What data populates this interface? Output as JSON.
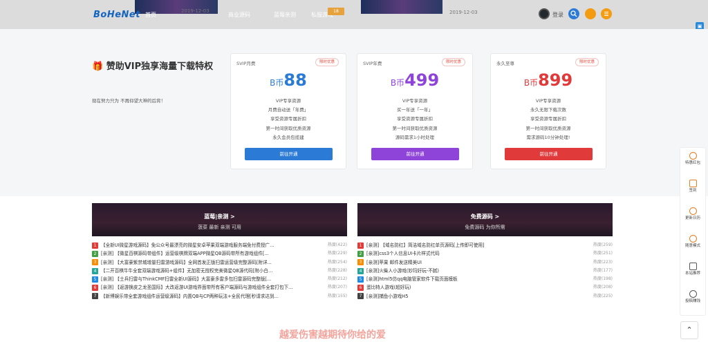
{
  "topbar": {
    "logo": "BoHeNet",
    "nav": [
      "首页",
      "商业源码",
      "蓝莓亲测",
      "私服游戏"
    ],
    "badge": "18",
    "dates": [
      "2019-12-03",
      "2019-12-03"
    ],
    "login": "登录"
  },
  "vip": {
    "title": "赞助VIP独享海量下载特权",
    "subtitle": "现在努力只为 不再仰望大神的后背！",
    "plans": [
      {
        "name": "SVIP月费",
        "badge": "限时优惠",
        "prefix": "B币",
        "price": "88",
        "color": "#2b7bd6",
        "features": [
          "VIP专享资源",
          "月费自动送「年费」",
          "享受资源专属折扣",
          "第一时间获取优质资源",
          "永久会员包揽建"
        ],
        "button": "前往开通"
      },
      {
        "name": "SVIP年费",
        "badge": "限时优惠",
        "prefix": "B币",
        "price": "499",
        "color": "#8e44d8",
        "features": [
          "VIP专享资源",
          "买一年送「一年」",
          "享受资源专属折扣",
          "第一时间获取优质资源",
          "源码需求1小时处理"
        ],
        "button": "前往开通"
      },
      {
        "name": "永久至尊",
        "badge": "限时优惠",
        "prefix": "B币",
        "price": "899",
        "color": "#e03a3a",
        "features": [
          "VIP专享资源",
          "永久无限下载次数",
          "享受资源专属折扣",
          "第一时间获取优质资源",
          "需求源码10分钟处理!"
        ],
        "button": "前往开通"
      }
    ]
  },
  "lists": [
    {
      "title": "蓝莓|亲测 >",
      "subtitle": "菠菜 最新 亲测 可用",
      "items": [
        {
          "text": "【全新UI微星游戏源码】免公众号最漂亮的微星安卓苹果双端游戏服务端免付费授广...",
          "heat": "热度(422)"
        },
        {
          "text": "[亲测] 【微星百棋源码带组件】运营级棋牌双端APP微星QB源码带所有游戏组件[...",
          "heat": "热度(229)"
        },
        {
          "text": "[亲测] 【大富豪紫禁城增量扫雷游戏源码】全网首发正版扫雷运营级完整源码[附详...",
          "heat": "热度(254)"
        },
        {
          "text": "【二开百棋牛牛全套双端游戏源码+组件】无加密无授权完美微星QB源代码[附小白...",
          "heat": "热度(228)"
        },
        {
          "text": "[亲测] 【士兵扫雷与ThinkCMF扫雷全新UI源码】大富豪多雷多包扫雷源码完整版[...",
          "heat": "热度(212)"
        },
        {
          "text": "[亲测] 【返游换皮之龙圣国际】大改返游UI游戏界面带所有客户端源码与游戏组件全套打包下...",
          "heat": "热度(207)"
        },
        {
          "text": "【新博娱乐带全套游戏组件运营级源码】内置QB与CP两种玩法+全民代理[秒请求达到...",
          "heat": "热度(155)"
        }
      ]
    },
    {
      "title": "免费源码 >",
      "subtitle": "免费源码 为你所需",
      "items": [
        {
          "text": "[亲测] 【域名防红】简洁域名防红单页源码[上传即可使用]",
          "heat": "热度(259)"
        },
        {
          "text": "[亲测]css3个人信息UI卡片样式代码",
          "heat": "热度(251)"
        },
        {
          "text": "[亲测]苹果 邮件发送精美UI",
          "heat": "热度(223)"
        },
        {
          "text": "[亲测]火柴人小游戏(妙玛好玩-不腻)",
          "heat": "热度(177)"
        },
        {
          "text": "[亲测]html5仿qq电脑管家软件下载页面模板",
          "heat": "热度(198)"
        },
        {
          "text": "蛋比特人游戏(超好玩)",
          "heat": "热度(208)"
        },
        {
          "text": "[亲测]捕鱼小游戏H5",
          "heat": "热度(225)"
        }
      ]
    }
  ],
  "rank_colors": [
    "#e53935",
    "#43a047",
    "#fb8c00",
    "#26a69a",
    "#1e88e5",
    "#e53935",
    "#424242"
  ],
  "sidebar": [
    "特惠红包",
    "签到",
    "更新日历",
    "随意模式",
    "本站推荐",
    "投稿赚钱"
  ],
  "bottom_text": "越爱伤害越期待你给的爱"
}
